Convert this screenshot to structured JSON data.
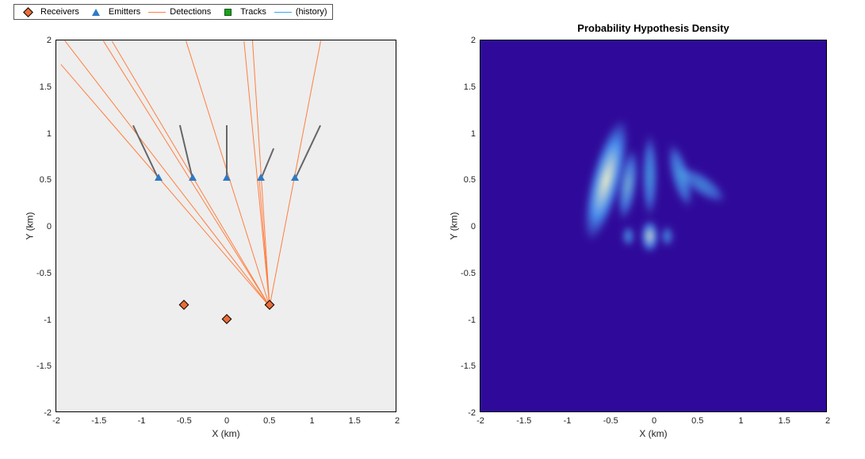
{
  "legend": {
    "items": [
      {
        "label": "Receivers"
      },
      {
        "label": "Emitters"
      },
      {
        "label": "Detections"
      },
      {
        "label": "Tracks"
      },
      {
        "label": "(history)"
      }
    ]
  },
  "axes_left": {
    "xlabel": "X (km)",
    "ylabel": "Y (km)",
    "xticks": [
      "-2",
      "-1.5",
      "-1",
      "-0.5",
      "0",
      "0.5",
      "1",
      "1.5",
      "2"
    ],
    "yticks": [
      "-2",
      "-1.5",
      "-1",
      "-0.5",
      "0",
      "0.5",
      "1",
      "1.5",
      "2"
    ]
  },
  "axes_right": {
    "title": "Probability Hypothesis Density",
    "xlabel": "X (km)",
    "ylabel": "Y (km)",
    "xticks": [
      "-2",
      "-1.5",
      "-1",
      "-0.5",
      "0",
      "0.5",
      "1",
      "1.5",
      "2"
    ],
    "yticks": [
      "-2",
      "-1.5",
      "-1",
      "-0.5",
      "0",
      "0.5",
      "1",
      "1.5",
      "2"
    ]
  },
  "chart_data": [
    {
      "type": "scatter",
      "title": "",
      "xlabel": "X (km)",
      "ylabel": "Y (km)",
      "xlim": [
        -2,
        2
      ],
      "ylim": [
        -2,
        2
      ],
      "series": [
        {
          "name": "Receivers",
          "marker": "diamond",
          "color": "#e86e39",
          "points": [
            {
              "x": -0.5,
              "y": -0.85
            },
            {
              "x": 0.0,
              "y": -1.0
            },
            {
              "x": 0.5,
              "y": -0.85
            }
          ]
        },
        {
          "name": "Emitters",
          "marker": "triangle",
          "color": "#2e7ac4",
          "points": [
            {
              "x": -0.8,
              "y": 0.52
            },
            {
              "x": -0.4,
              "y": 0.52
            },
            {
              "x": 0.0,
              "y": 0.52
            },
            {
              "x": 0.4,
              "y": 0.52
            },
            {
              "x": 0.8,
              "y": 0.52
            }
          ],
          "velocity_sticks": [
            {
              "x0": -0.8,
              "y0": 0.52,
              "x1": -1.1,
              "y1": 1.1
            },
            {
              "x0": -0.4,
              "y0": 0.52,
              "x1": -0.55,
              "y1": 1.1
            },
            {
              "x0": 0.0,
              "y0": 0.52,
              "x1": 0.0,
              "y1": 1.1
            },
            {
              "x0": 0.4,
              "y0": 0.52,
              "x1": 0.55,
              "y1": 0.85
            },
            {
              "x0": 0.8,
              "y0": 0.52,
              "x1": 1.1,
              "y1": 1.1
            }
          ]
        },
        {
          "name": "Detections",
          "type": "line",
          "color": "#ff7f3f",
          "segments": [
            {
              "x0": 0.5,
              "y0": -0.85,
              "x1": -1.95,
              "y1": 1.75
            },
            {
              "x0": 0.5,
              "y0": -0.85,
              "x1": -1.9,
              "y1": 2.0
            },
            {
              "x0": 0.5,
              "y0": -0.85,
              "x1": -1.45,
              "y1": 2.0
            },
            {
              "x0": 0.5,
              "y0": -0.85,
              "x1": -1.35,
              "y1": 2.0
            },
            {
              "x0": 0.5,
              "y0": -0.85,
              "x1": -0.48,
              "y1": 2.0
            },
            {
              "x0": 0.5,
              "y0": -0.85,
              "x1": 0.2,
              "y1": 2.0
            },
            {
              "x0": 0.5,
              "y0": -0.85,
              "x1": 0.3,
              "y1": 2.0
            },
            {
              "x0": 0.5,
              "y0": -0.85,
              "x1": 1.1,
              "y1": 2.0
            },
            {
              "x0": 0.5,
              "y0": -0.85,
              "x1": 0.38,
              "y1": 0.5
            }
          ]
        },
        {
          "name": "Tracks",
          "marker": "square",
          "color": "#1f9e1f",
          "points": []
        },
        {
          "name": "(history)",
          "type": "line",
          "color": "#2fa7ff",
          "segments": []
        }
      ]
    },
    {
      "type": "heatmap",
      "title": "Probability Hypothesis Density",
      "xlabel": "X (km)",
      "ylabel": "Y (km)",
      "xlim": [
        -2,
        2
      ],
      "ylim": [
        -2,
        2
      ],
      "colormap": "parula",
      "background": "#2f0a9a",
      "peaks": [
        {
          "x": -0.55,
          "y": 0.5,
          "sx": 0.1,
          "sy": 0.38,
          "intensity": 1.0,
          "angle": 15
        },
        {
          "x": -0.3,
          "y": 0.45,
          "sx": 0.06,
          "sy": 0.22,
          "intensity": 0.6,
          "angle": 8
        },
        {
          "x": -0.05,
          "y": 0.55,
          "sx": 0.05,
          "sy": 0.25,
          "intensity": 0.55,
          "angle": 0
        },
        {
          "x": 0.3,
          "y": 0.55,
          "sx": 0.06,
          "sy": 0.2,
          "intensity": 0.55,
          "angle": -15
        },
        {
          "x": 0.55,
          "y": 0.45,
          "sx": 0.18,
          "sy": 0.06,
          "intensity": 0.4,
          "angle": 35
        },
        {
          "x": -0.3,
          "y": -0.1,
          "sx": 0.04,
          "sy": 0.06,
          "intensity": 0.5,
          "angle": 0
        },
        {
          "x": -0.05,
          "y": -0.1,
          "sx": 0.06,
          "sy": 0.1,
          "intensity": 0.85,
          "angle": 0
        },
        {
          "x": 0.15,
          "y": -0.1,
          "sx": 0.04,
          "sy": 0.06,
          "intensity": 0.45,
          "angle": 0
        }
      ]
    }
  ]
}
